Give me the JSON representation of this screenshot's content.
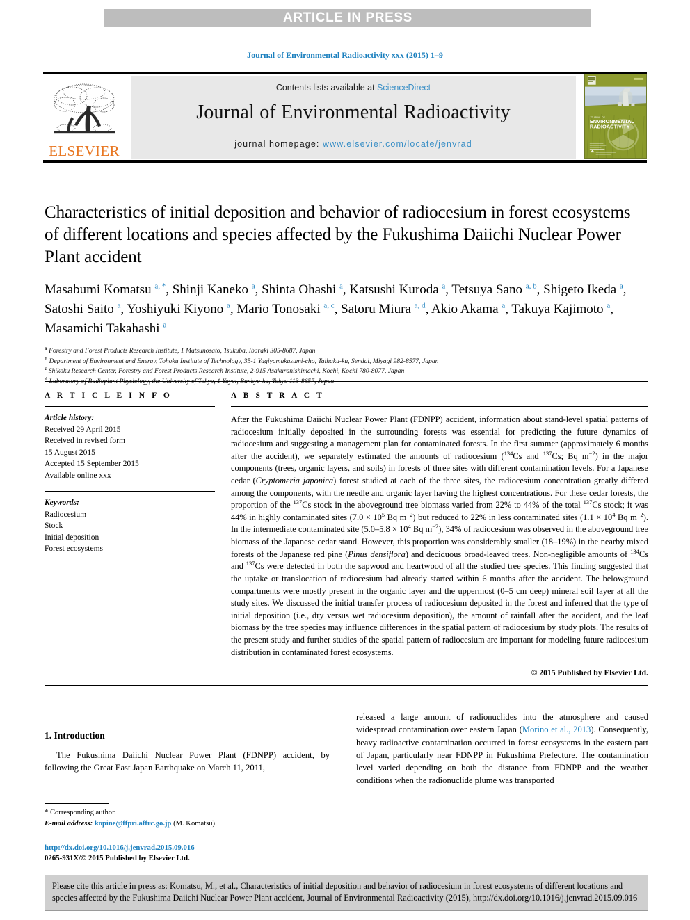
{
  "banner": {
    "label": "ARTICLE IN PRESS"
  },
  "running_head": "Journal of Environmental Radioactivity xxx (2015) 1–9",
  "masthead": {
    "contents_prefix": "Contents lists available at ",
    "sciencedirect": "ScienceDirect",
    "journal_title": "Journal of Environmental Radioactivity",
    "homepage_prefix": "journal homepage: ",
    "homepage_url": "www.elsevier.com/locate/jenvrad",
    "publisher_wordmark": "ELSEVIER",
    "cover_title_line1": "JOURNAL OF",
    "cover_title_line2": "ENVIRONMENTAL",
    "cover_title_line3": "RADIOACTIVITY",
    "colors": {
      "banner_bg": "#bdbdbd",
      "masthead_bg": "#e8e8e8",
      "link_blue": "#3a8fc6",
      "elsevier_orange": "#e87722",
      "cover_olive": "#8d9b2e"
    }
  },
  "article": {
    "title": "Characteristics of initial deposition and behavior of radiocesium in forest ecosystems of different locations and species affected by the Fukushima Daiichi Nuclear Power Plant accident",
    "authors_html": "Masabumi Komatsu <sup>a, *</sup>, Shinji Kaneko <sup>a</sup>, Shinta Ohashi <sup>a</sup>, Katsushi Kuroda <sup>a</sup>, Tetsuya Sano <sup>a, b</sup>, Shigeto Ikeda <sup>a</sup>, Satoshi Saito <sup>a</sup>, Yoshiyuki Kiyono <sup>a</sup>, Mario Tonosaki <sup>a, c</sup>, Satoru Miura <sup>a, d</sup>, Akio Akama <sup>a</sup>, Takuya Kajimoto <sup>a</sup>, Masamichi Takahashi <sup>a</sup>",
    "affiliations": [
      {
        "mark": "a",
        "text": "Forestry and Forest Products Research Institute, 1 Matsunosato, Tsukuba, Ibaraki 305-8687, Japan"
      },
      {
        "mark": "b",
        "text": "Department of Environment and Energy, Tohoku Institute of Technology, 35-1 Yagiyamakasumi-cho, Taihaku-ku, Sendai, Miyagi 982-8577, Japan"
      },
      {
        "mark": "c",
        "text": "Shikoku Research Center, Forestry and Forest Products Research Institute, 2-915 Asakuranishimachi, Kochi, Kochi 780-8077, Japan"
      },
      {
        "mark": "d",
        "text": "Laboratory of Radioplant Physiology, the University of Tokyo, 1 Yayoi, Bunkyo-ku, Tokyo 113-8657, Japan"
      }
    ]
  },
  "article_info": {
    "heading": "A R T I C L E   I N F O",
    "history_label": "Article history:",
    "history_lines": [
      "Received 29 April 2015",
      "Received in revised form",
      "15 August 2015",
      "Accepted 15 September 2015",
      "Available online xxx"
    ],
    "keywords_label": "Keywords:",
    "keywords": [
      "Radiocesium",
      "Stock",
      "Initial deposition",
      "Forest ecosystems"
    ]
  },
  "abstract": {
    "heading": "A B S T R A C T",
    "body_html": "After the Fukushima Daiichi Nuclear Power Plant (FDNPP) accident, information about stand-level spatial patterns of radiocesium initially deposited in the surrounding forests was essential for predicting the future dynamics of radiocesium and suggesting a management plan for contaminated forests. In the first summer (approximately 6 months after the accident), we separately estimated the amounts of radiocesium (<sup>134</sup>Cs and <sup>137</sup>Cs; Bq m<sup>−2</sup>) in the major components (trees, organic layers, and soils) in forests of three sites with different contamination levels. For a Japanese cedar (<i>Cryptomeria japonica</i>) forest studied at each of the three sites, the radiocesium concentration greatly differed among the components, with the needle and organic layer having the highest concentrations. For these cedar forests, the proportion of the <sup>137</sup>Cs stock in the aboveground tree biomass varied from 22% to 44% of the total <sup>137</sup>Cs stock; it was 44% in highly contaminated sites (7.0 × 10<sup>5</sup> Bq m<sup>−2</sup>) but reduced to 22% in less contaminated sites (1.1 × 10<sup>4</sup> Bq m<sup>−2</sup>). In the intermediate contaminated site (5.0–5.8 × 10<sup>4</sup> Bq m<sup>−2</sup>), 34% of radiocesium was observed in the aboveground tree biomass of the Japanese cedar stand. However, this proportion was considerably smaller (18–19%) in the nearby mixed forests of the Japanese red pine (<i>Pinus densiflora</i>) and deciduous broad-leaved trees. Non-negligible amounts of <sup>134</sup>Cs and <sup>137</sup>Cs were detected in both the sapwood and heartwood of all the studied tree species. This finding suggested that the uptake or translocation of radiocesium had already started within 6 months after the accident. The belowground compartments were mostly present in the organic layer and the uppermost (0–5 cm deep) mineral soil layer at all the study sites. We discussed the initial transfer process of radiocesium deposited in the forest and inferred that the type of initial deposition (i.e., dry versus wet radiocesium deposition), the amount of rainfall after the accident, and the leaf biomass by the tree species may influence differences in the spatial pattern of radiocesium by study plots. The results of the present study and further studies of the spatial pattern of radiocesium are important for modeling future radiocesium distribution in contaminated forest ecosystems.",
    "copyright": "© 2015 Published by Elsevier Ltd."
  },
  "introduction": {
    "heading": "1.  Introduction",
    "left_para_html": "The Fukushima Daiichi Nuclear Power Plant (FDNPP) accident, by following the Great East Japan Earthquake on March 11, 2011,",
    "right_para_html": "released a large amount of radionuclides into the atmosphere and caused widespread contamination over eastern Japan (<span class=\"link\">Morino et al., 2013</span>). Consequently, heavy radioactive contamination occurred in forest ecosystems in the eastern part of Japan, particularly near FDNPP in Fukushima Prefecture. The contamination level varied depending on both the distance from FDNPP and the weather conditions when the radionuclide plume was transported"
  },
  "footnote": {
    "corresponding": "* Corresponding author.",
    "email_label": "E-mail address:",
    "email": "kopine@ffpri.affrc.go.jp",
    "email_owner": "(M. Komatsu)."
  },
  "doi_block": {
    "doi": "http://dx.doi.org/10.1016/j.jenvrad.2015.09.016",
    "issn": "0265-931X/© 2015 Published by Elsevier Ltd."
  },
  "cite_box": {
    "text": "Please cite this article in press as: Komatsu, M., et al., Characteristics of initial deposition and behavior of radiocesium in forest ecosystems of different locations and species affected by the Fukushima Daiichi Nuclear Power Plant accident, Journal of Environmental Radioactivity (2015), http://dx.doi.org/10.1016/j.jenvrad.2015.09.016"
  }
}
